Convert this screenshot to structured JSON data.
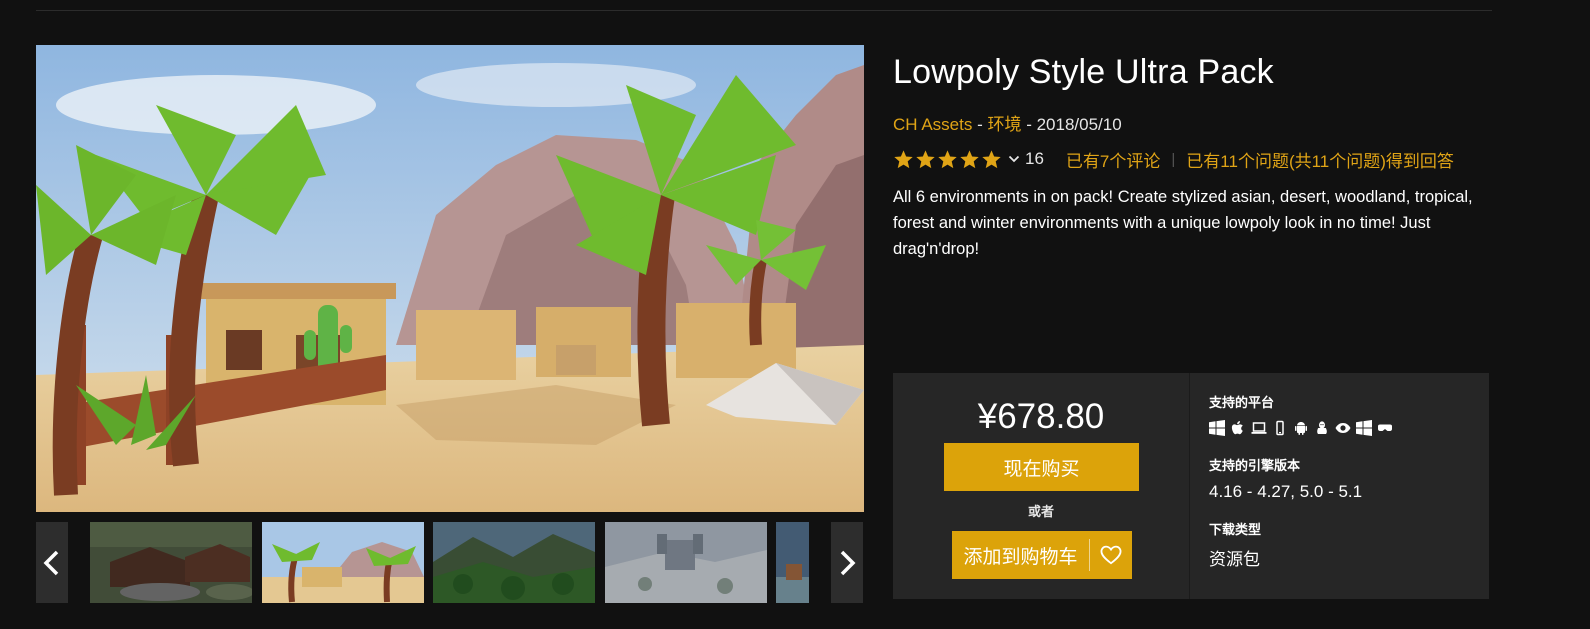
{
  "product": {
    "title": "Lowpoly Style Ultra Pack",
    "publisher": "CH Assets",
    "meta_sep1": " - ",
    "category": "环境",
    "meta_sep2": " - ",
    "date": "2018/05/10",
    "rating": 5,
    "rating_count": "16",
    "reviews_link": "已有7个评论",
    "questions_link": "已有11个问题(共11个问题)得到回答",
    "description": "All 6 environments in on pack! Create stylized asian, desert, woodland, tropical, forest and winter environments with a unique lowpoly look in no time! Just drag'n'drop!"
  },
  "gallery": {
    "prev_icon": "chevron-left-icon",
    "next_icon": "chevron-right-icon",
    "thumbnails": [
      "asian-village-scene",
      "desert-oasis-scene",
      "forest-valley-scene",
      "winter-castle-scene",
      "tropical-scene-partial"
    ],
    "selected_index": 1
  },
  "purchase": {
    "price": "¥678.80",
    "buy_now": "现在购买",
    "or": "或者",
    "add_to_cart": "添加到购物车",
    "wishlist_icon": "heart-icon"
  },
  "specs": {
    "platforms_label": "支持的平台",
    "platforms": [
      "windows-icon",
      "apple-icon",
      "laptop-icon",
      "mobile-icon",
      "android-icon",
      "linux-icon",
      "eye-vr-icon",
      "windows-icon",
      "vr-headset-icon"
    ],
    "engine_label": "支持的引擎版本",
    "engine_versions": "4.16 - 4.27, 5.0 - 5.1",
    "download_label": "下载类型",
    "download_type": "资源包"
  },
  "colors": {
    "background": "#111111",
    "accent": "#dca30a",
    "link": "#e0a416",
    "panel": "#262626"
  }
}
